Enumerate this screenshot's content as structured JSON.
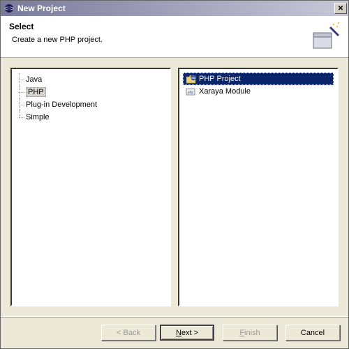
{
  "window": {
    "title": "New Project",
    "close_glyph": "✕"
  },
  "banner": {
    "title": "Select",
    "description": "Create a new PHP project."
  },
  "categories": {
    "items": [
      {
        "label": "Java",
        "selected": false
      },
      {
        "label": "PHP",
        "selected": true
      },
      {
        "label": "Plug-in Development",
        "selected": false
      },
      {
        "label": "Simple",
        "selected": false
      }
    ]
  },
  "wizards": {
    "items": [
      {
        "label": "PHP Project",
        "icon": "php-project-icon",
        "selected": true
      },
      {
        "label": "Xaraya Module",
        "icon": "xaraya-module-icon",
        "selected": false
      }
    ]
  },
  "buttons": {
    "back": "< Back",
    "next_prefix": "N",
    "next_rest": "ext >",
    "finish_prefix": "F",
    "finish_rest": "inish",
    "cancel": "Cancel"
  }
}
